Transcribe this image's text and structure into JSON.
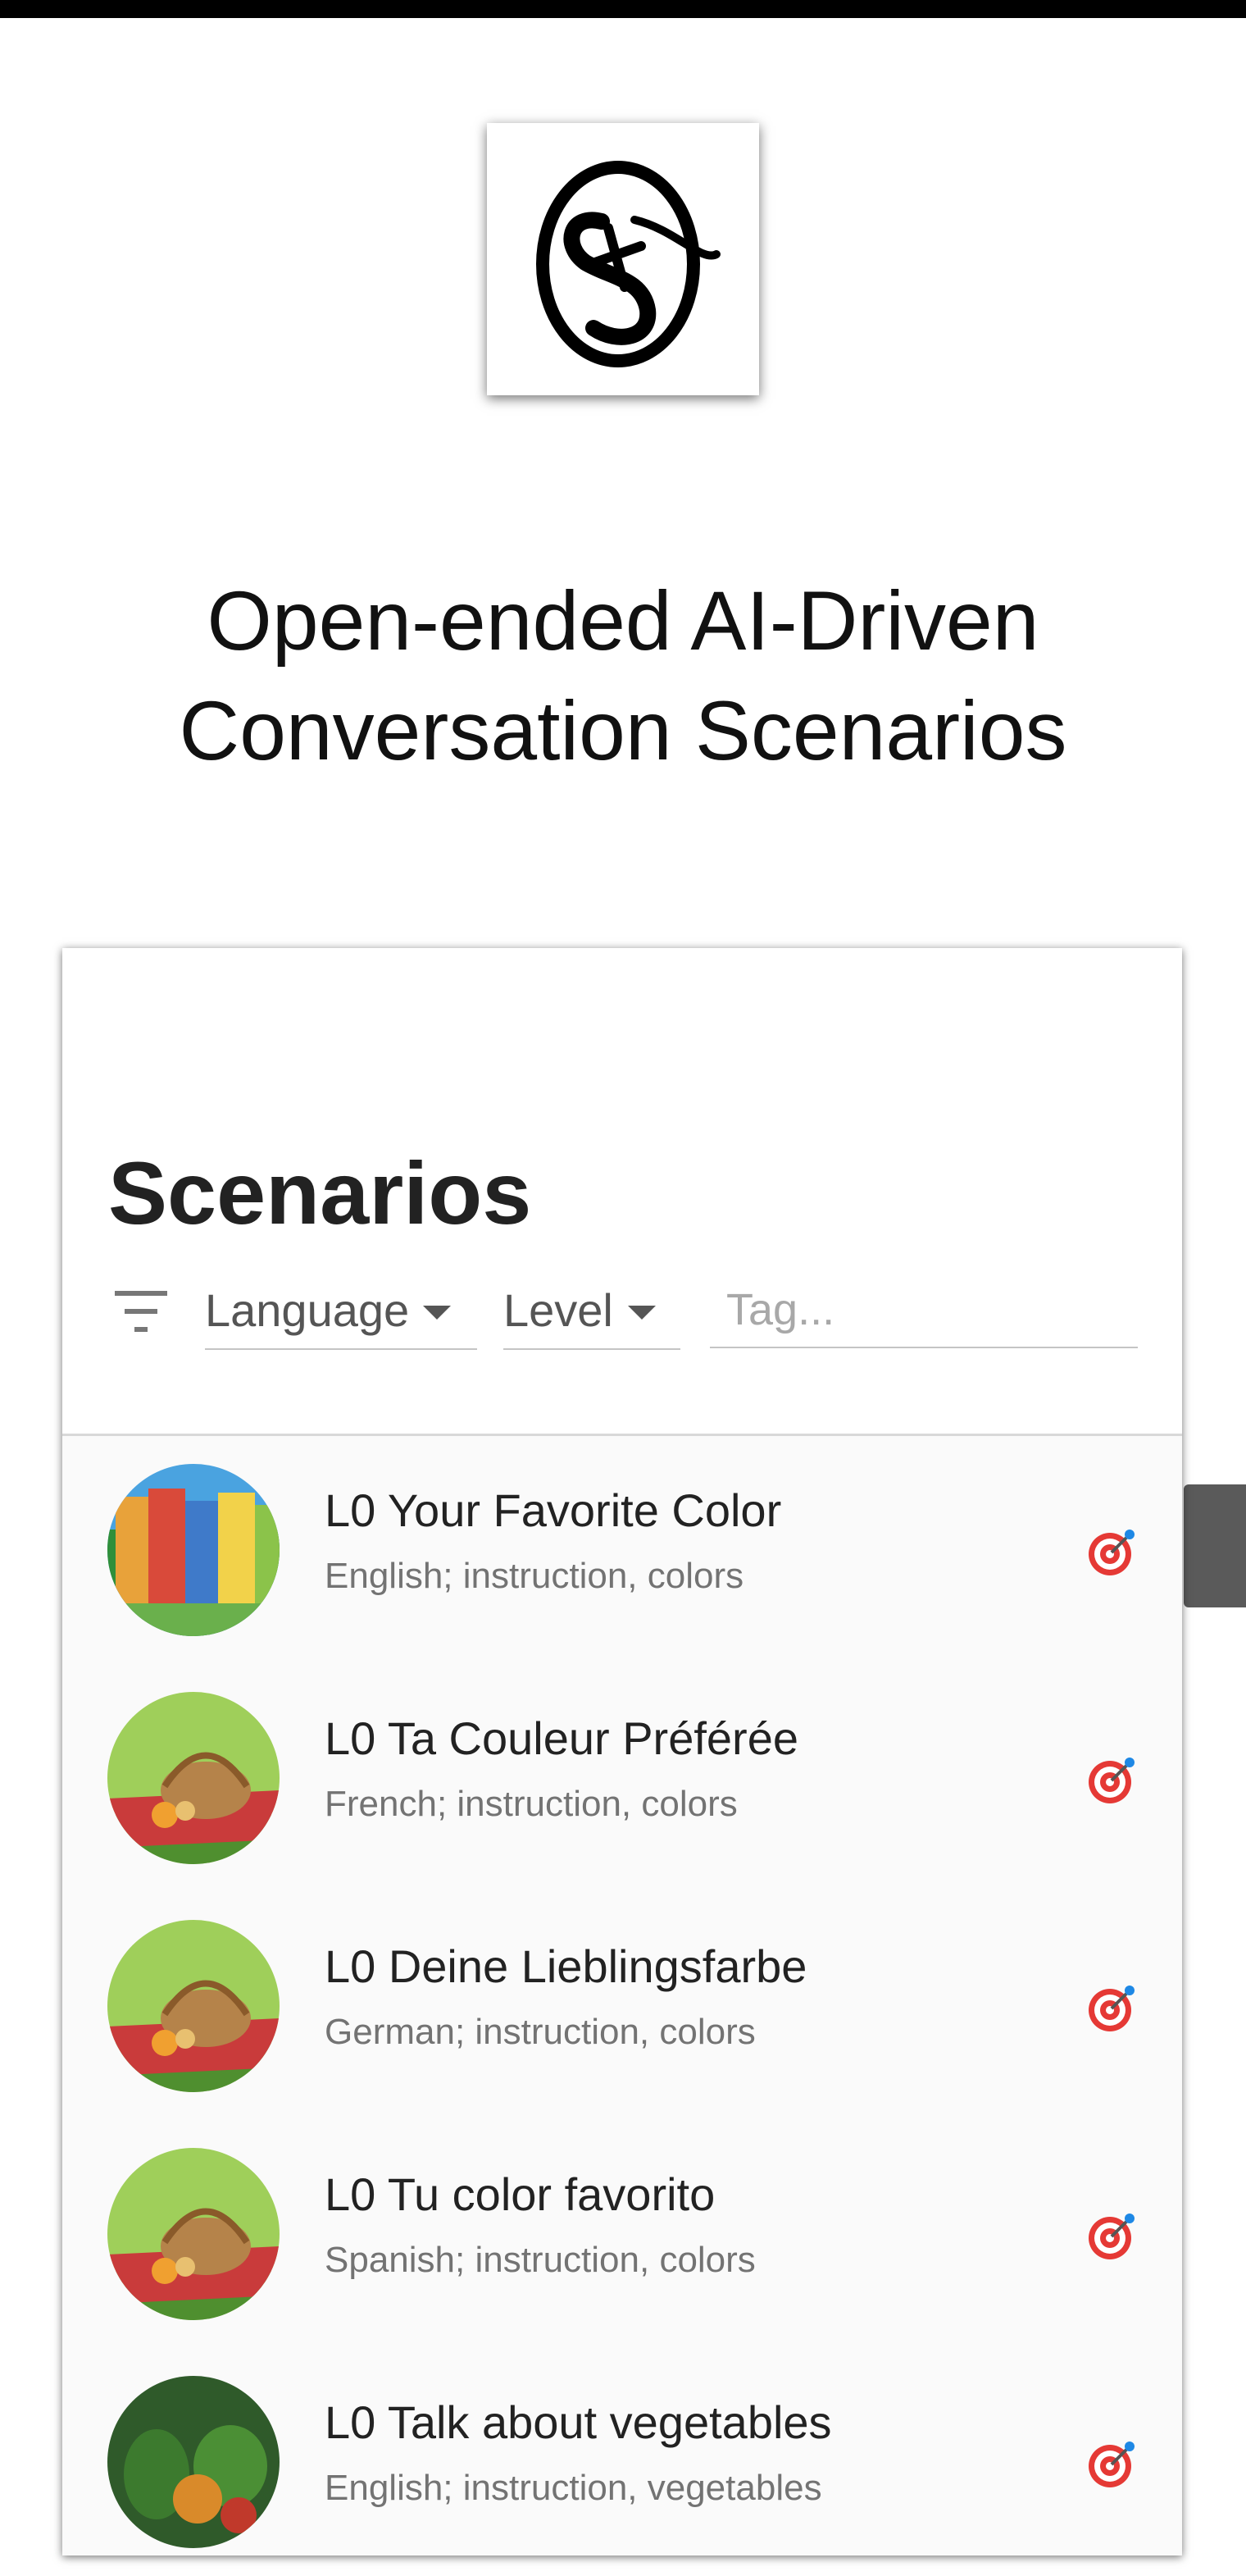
{
  "hero": {
    "title_line1": "Open-ended AI-Driven",
    "title_line2": "Conversation Scenarios"
  },
  "logo": {
    "icon": "swirl-s-logo"
  },
  "scenarios": {
    "title": "Scenarios",
    "filters": {
      "language_label": "Language",
      "level_label": "Level",
      "tag_placeholder": "Tag..."
    },
    "items": [
      {
        "title": "L0 Your Favorite Color",
        "subtitle": "English; instruction, colors",
        "image": "colorful-buildings",
        "icon": "target-icon"
      },
      {
        "title": "L0 Ta Couleur Préférée",
        "subtitle": "French; instruction, colors",
        "image": "picnic-basket",
        "icon": "target-icon"
      },
      {
        "title": "L0 Deine Lieblingsfarbe",
        "subtitle": "German; instruction, colors",
        "image": "picnic-basket",
        "icon": "target-icon"
      },
      {
        "title": "L0 Tu color favorito",
        "subtitle": "Spanish; instruction, colors",
        "image": "picnic-basket",
        "icon": "target-icon"
      },
      {
        "title": "L0 Talk about vegetables",
        "subtitle": "English; instruction, vegetables",
        "image": "vegetables",
        "icon": "target-icon"
      }
    ]
  },
  "colors": {
    "accent": "#e53935",
    "target_blue": "#1e88e5"
  }
}
